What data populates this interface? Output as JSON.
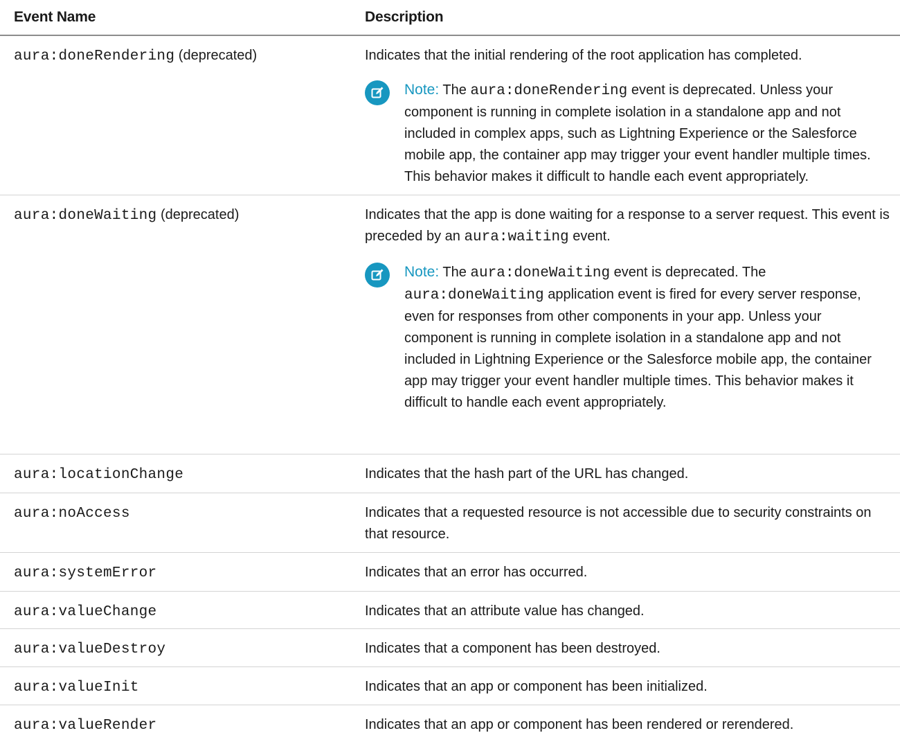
{
  "table": {
    "headers": {
      "event_name": "Event Name",
      "description": "Description"
    },
    "rows": [
      {
        "event": "aura:doneRendering",
        "suffix": " (deprecated)",
        "description": "Indicates that the initial rendering of the root application has completed.",
        "note": {
          "label": "Note:",
          "pre": " The ",
          "code": "aura:doneRendering",
          "post": " event is deprecated. Unless your component is running in complete isolation in a standalone app and not included in complex apps, such as Lightning Experience or the Salesforce mobile app, the container app may trigger your event handler multiple times. This behavior makes it difficult to handle each event appropriately."
        }
      },
      {
        "event": "aura:doneWaiting",
        "suffix": " (deprecated)",
        "description_pre": "Indicates that the app is done waiting for a response to a server request. This event is preceded by an ",
        "description_code": "aura:waiting",
        "description_post": " event.",
        "note": {
          "label": "Note:",
          "pre": " The ",
          "code": "aura:doneWaiting",
          "mid": " event is deprecated. The ",
          "code2": "aura:doneWaiting",
          "post": " application event is fired for every server response, even for responses from other components in your app. Unless your component is running in complete isolation in a standalone app and not included in Lightning Experience or the Salesforce mobile app, the container app may trigger your event handler multiple times. This behavior makes it difficult to handle each event appropriately."
        }
      },
      {
        "event": "aura:locationChange",
        "description": "Indicates that the hash part of the URL has changed."
      },
      {
        "event": "aura:noAccess",
        "description": "Indicates that a requested resource is not accessible due to security constraints on that resource."
      },
      {
        "event": "aura:systemError",
        "description": "Indicates that an error has occurred."
      },
      {
        "event": "aura:valueChange",
        "description": "Indicates that an attribute value has changed."
      },
      {
        "event": "aura:valueDestroy",
        "description": "Indicates that a component has been destroyed."
      },
      {
        "event": "aura:valueInit",
        "description": "Indicates that an app or component has been initialized."
      },
      {
        "event": "aura:valueRender",
        "description": "Indicates that an app or component has been rendered or rerendered."
      }
    ]
  },
  "icons": {
    "note": "note-edit-icon"
  },
  "colors": {
    "accent": "#1797c0",
    "header_rule": "#8c8c8c",
    "row_rule": "#d4d4d4"
  }
}
